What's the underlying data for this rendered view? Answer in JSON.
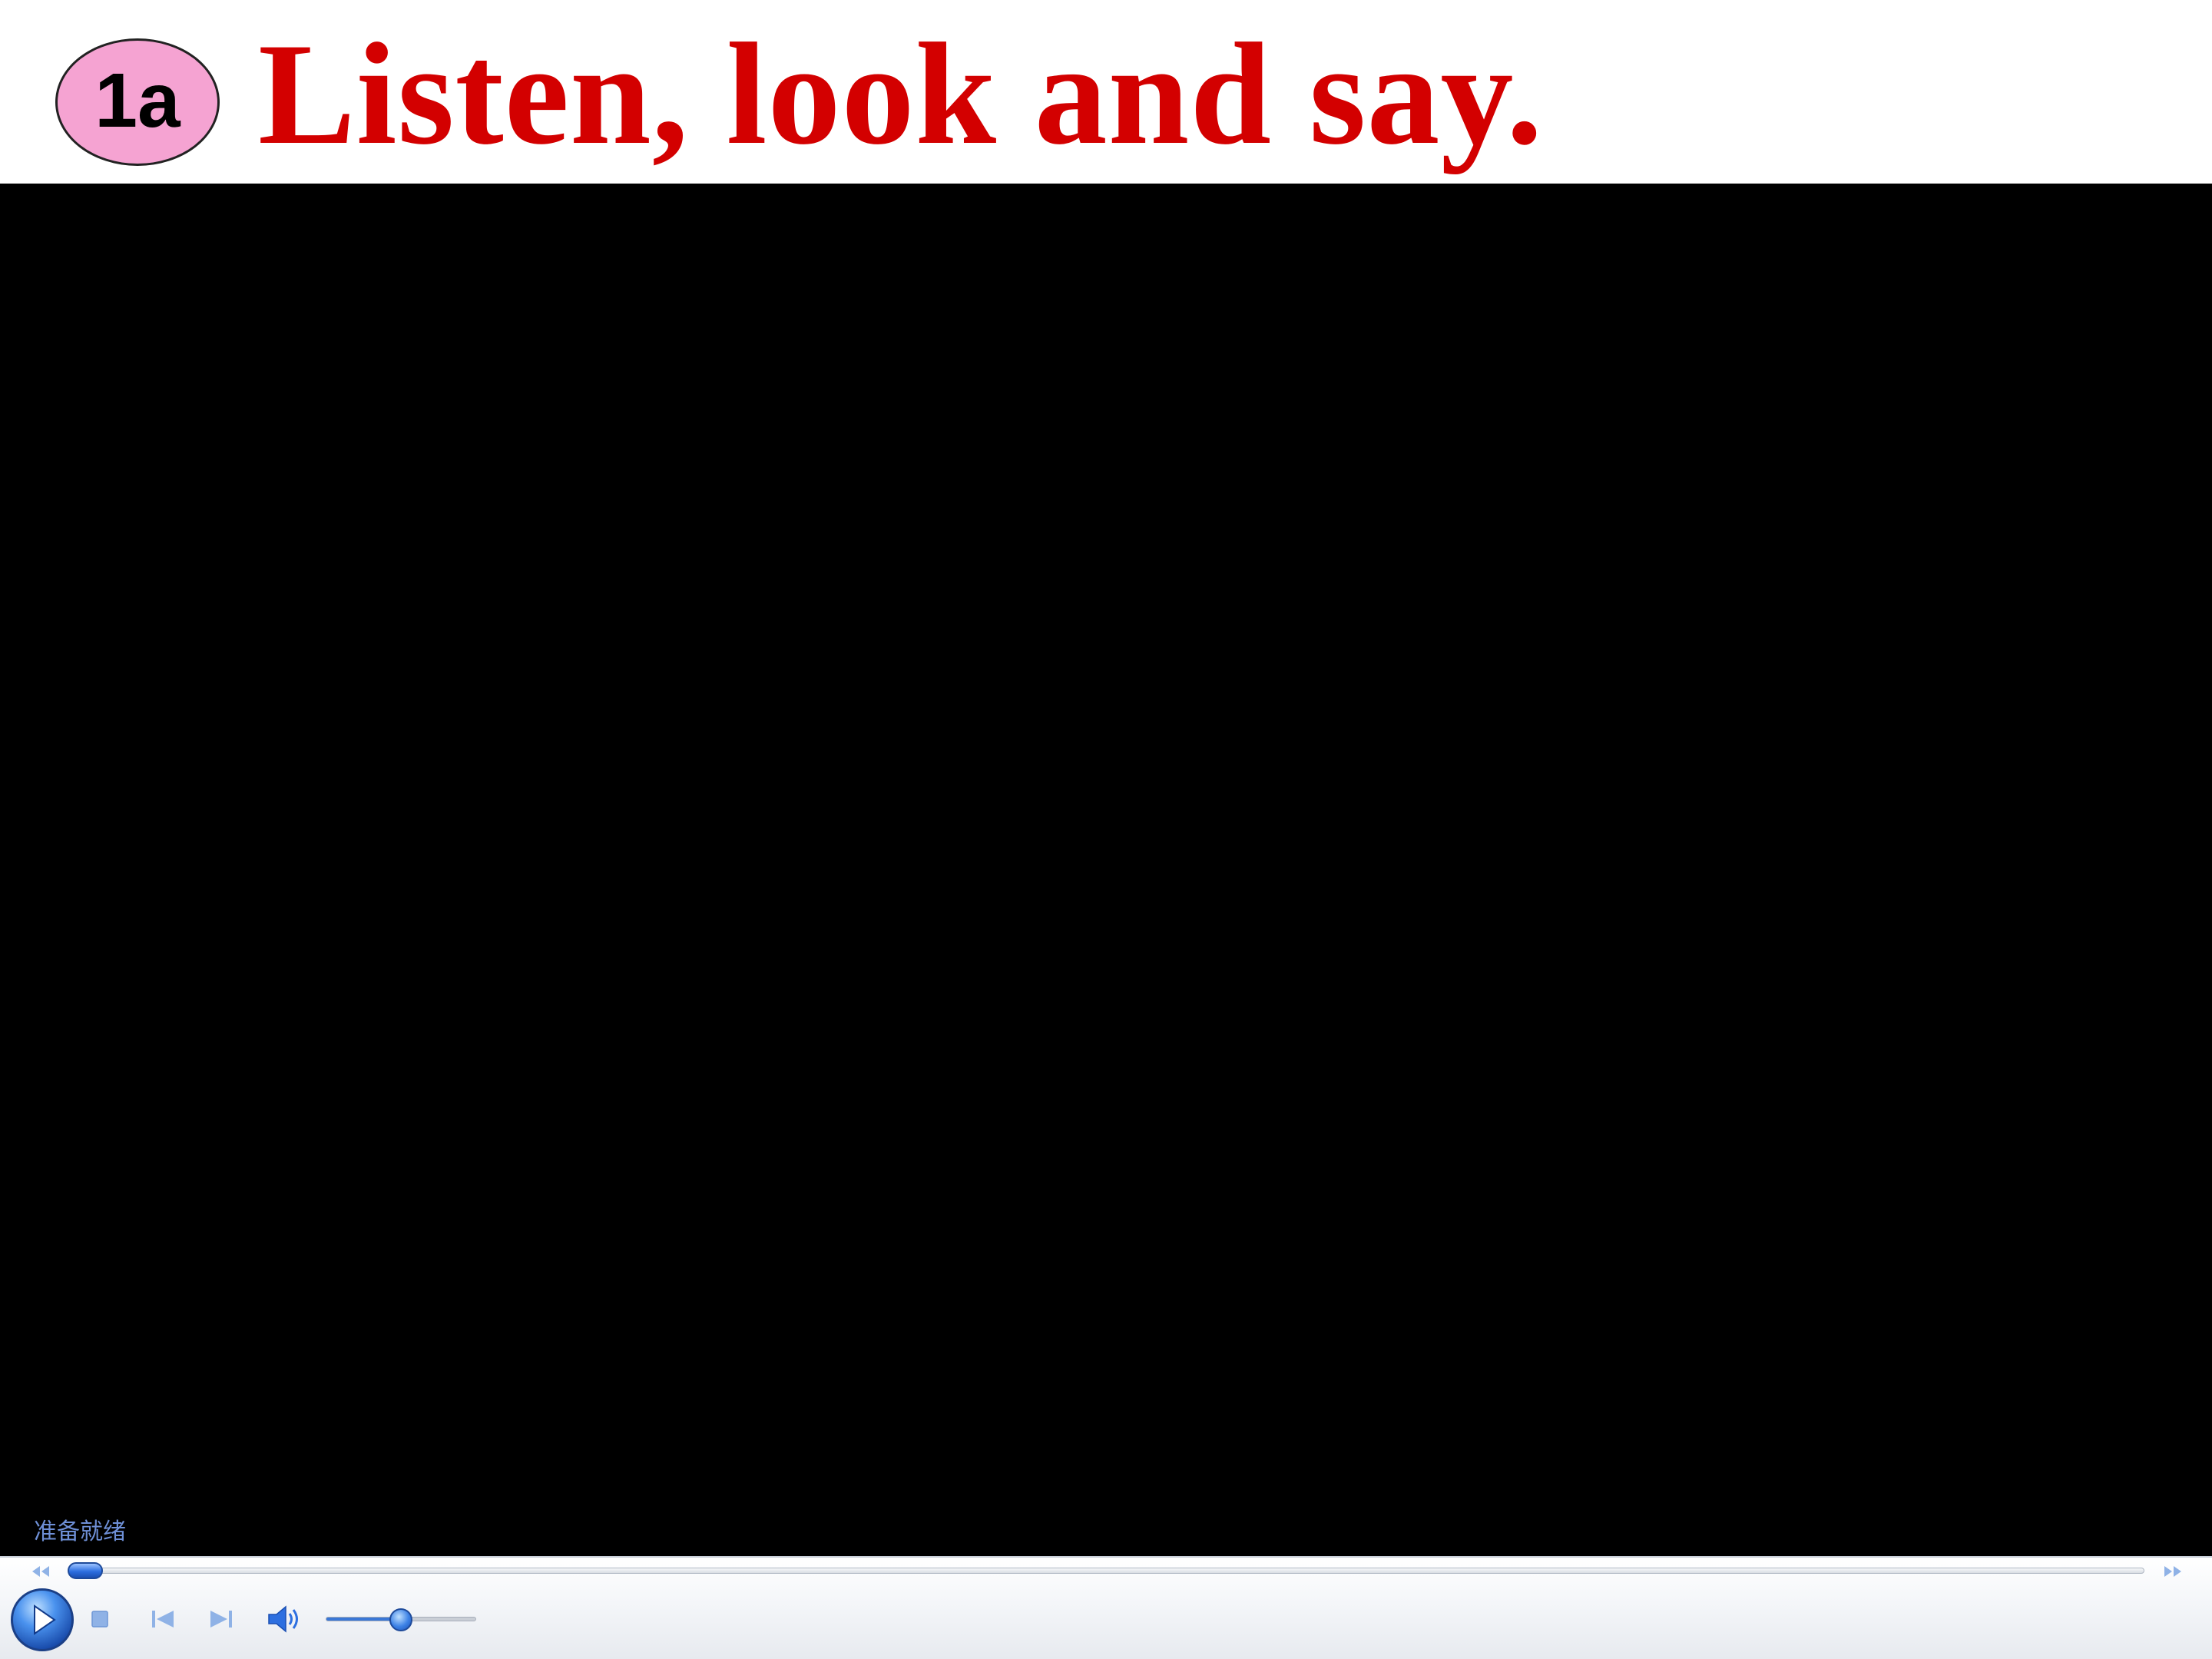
{
  "header": {
    "badge": "1a",
    "title": "Listen, look and say."
  },
  "player": {
    "status_text": "准备就绪",
    "seek_position": 0.0,
    "volume_level": 0.5,
    "icons": {
      "rewind": "rewind-icon",
      "fast_forward": "fast-forward-icon",
      "play": "play-icon",
      "stop": "stop-icon",
      "previous": "previous-track-icon",
      "next": "next-track-icon",
      "volume": "speaker-icon"
    },
    "colors": {
      "title": "#d30000",
      "badge_fill": "#f5a3d2",
      "accent": "#3a77d6",
      "status": "#6e8fd6",
      "video_bg": "#000000"
    }
  }
}
